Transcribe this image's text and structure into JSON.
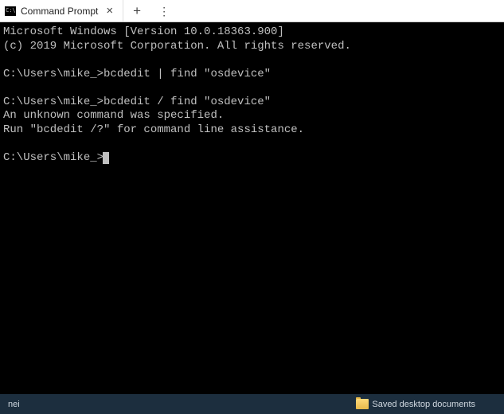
{
  "tab": {
    "title": "Command Prompt"
  },
  "terminal": {
    "line1": "Microsoft Windows [Version 10.0.18363.900]",
    "line2": "(c) 2019 Microsoft Corporation. All rights reserved.",
    "blank1": "",
    "line3": "C:\\Users\\mike_>bcdedit | find \"osdevice\"",
    "blank2": "",
    "line4": "C:\\Users\\mike_>bcdedit / find \"osdevice\"",
    "line5": "An unknown command was specified.",
    "line6": "Run \"bcdedit /?\" for command line assistance.",
    "blank3": "",
    "prompt": "C:\\Users\\mike_>"
  },
  "taskbar": {
    "item1": "nei",
    "item2": "Saved desktop documents"
  }
}
